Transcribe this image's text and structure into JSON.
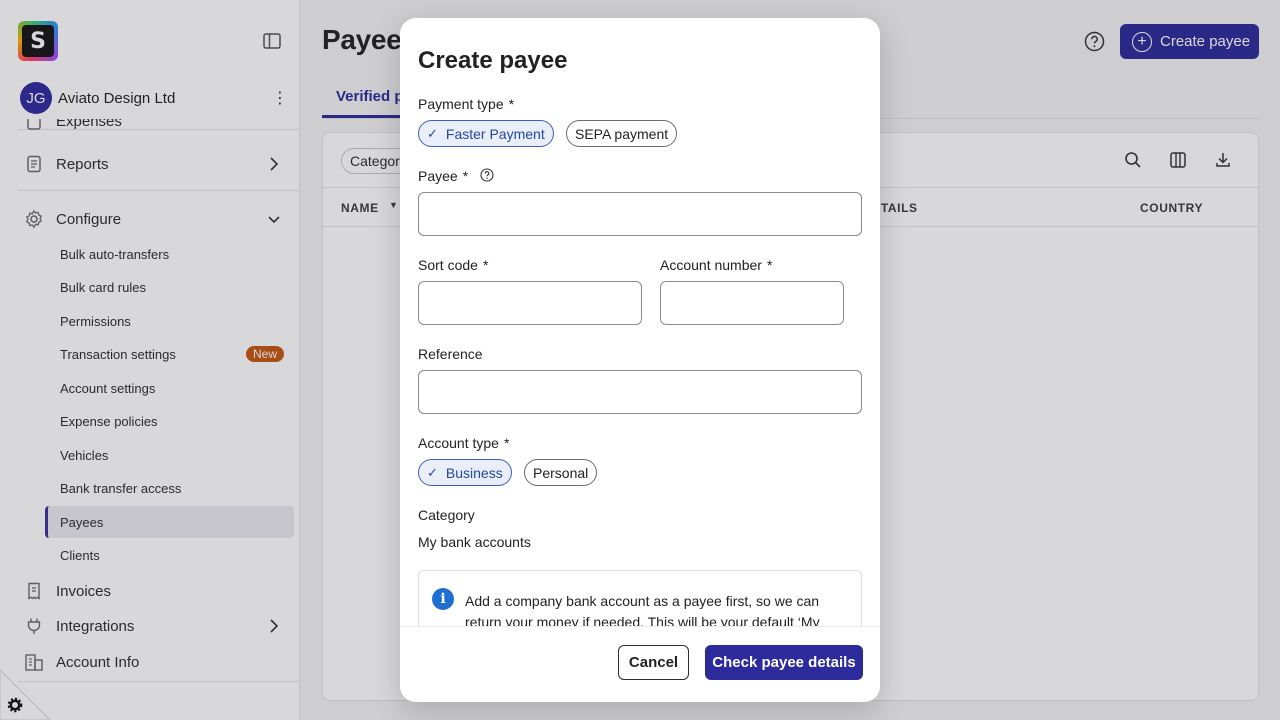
{
  "sidebar": {
    "logo_letter": "S",
    "account": {
      "initials": "JG",
      "name": "Aviato Design Ltd"
    },
    "cut_item": "Expenses",
    "items": [
      {
        "label": "Reports"
      },
      {
        "label": "Configure"
      },
      {
        "label": "Invoices"
      },
      {
        "label": "Integrations"
      },
      {
        "label": "Account Info"
      }
    ],
    "configure_subitems": [
      {
        "label": "Bulk auto-transfers"
      },
      {
        "label": "Bulk card rules"
      },
      {
        "label": "Permissions"
      },
      {
        "label": "Transaction settings",
        "badge": "New"
      },
      {
        "label": "Account settings"
      },
      {
        "label": "Expense policies"
      },
      {
        "label": "Vehicles"
      },
      {
        "label": "Bank transfer access"
      },
      {
        "label": "Payees"
      },
      {
        "label": "Clients"
      }
    ]
  },
  "header": {
    "title": "Payees",
    "create_button": "Create payee"
  },
  "tabs": [
    {
      "label": "Verified payees"
    }
  ],
  "table": {
    "filter_label": "Category",
    "columns": [
      "NAME",
      "DETAILS",
      "COUNTRY"
    ]
  },
  "modal": {
    "title": "Create payee",
    "payment_type": {
      "label": "Payment type",
      "required": "*",
      "options": [
        {
          "label": "Faster Payment",
          "selected": true
        },
        {
          "label": "SEPA payment",
          "selected": false
        }
      ]
    },
    "payee": {
      "label": "Payee",
      "required": "*",
      "value": ""
    },
    "sort_code": {
      "label": "Sort code",
      "required": "*",
      "value": ""
    },
    "account_number": {
      "label": "Account number",
      "required": "*",
      "value": ""
    },
    "reference": {
      "label": "Reference",
      "value": ""
    },
    "account_type": {
      "label": "Account type",
      "required": "*",
      "options": [
        {
          "label": "Business",
          "selected": true
        },
        {
          "label": "Personal",
          "selected": false
        }
      ]
    },
    "category": {
      "label": "Category",
      "value": "My bank accounts"
    },
    "info_text": "Add a company bank account as a payee first, so we can return your money if needed. This will be your default ‘My",
    "cancel_label": "Cancel",
    "submit_label": "Check payee details"
  },
  "colors": {
    "accent": "#2d2a9c",
    "selected_chip": "#e9eef9",
    "badge": "#c65612",
    "info": "#1f6fd1"
  }
}
